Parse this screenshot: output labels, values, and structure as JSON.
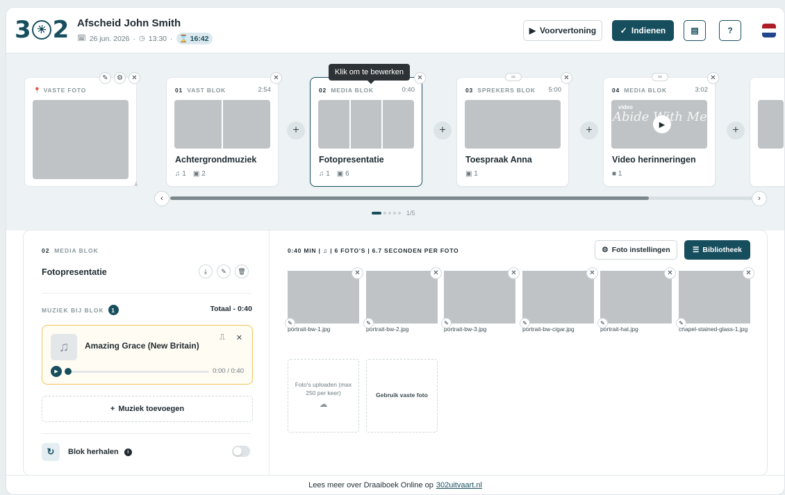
{
  "header": {
    "logo": "302",
    "title": "Afscheid John Smith",
    "date": "26 jun. 2026",
    "time": "13:30",
    "duration": "16:42",
    "preview_label": "Voorvertoning",
    "submit_label": "Indienen",
    "help_label": "?"
  },
  "timeline": {
    "tooltip": "Klik om te bewerken",
    "fixed_photo_label": "VASTE FOTO",
    "pagination": "1/5",
    "cards": [
      {
        "num": "01",
        "type": "VAST BLOK",
        "time": "2:54",
        "title": "Achtergrondmuziek",
        "music": "1",
        "photos": "2"
      },
      {
        "num": "02",
        "type": "MEDIA BLOK",
        "time": "0:40",
        "title": "Fotopresentatie",
        "music": "1",
        "photos": "6"
      },
      {
        "num": "03",
        "type": "SPREKERS BLOK",
        "time": "5:00",
        "title": "Toespraak Anna",
        "photos": "1"
      },
      {
        "num": "04",
        "type": "MEDIA BLOK",
        "time": "3:02",
        "title": "Video herinneringen",
        "videos": "1",
        "video_tag": "video",
        "video_overlay": "Abide With Me"
      }
    ]
  },
  "editor": {
    "num": "02",
    "type": "MEDIA BLOK",
    "title": "Fotopresentatie",
    "music_label": "MUZIEK BIJ BLOK",
    "music_count": "1",
    "music_total": "Totaal - 0:40",
    "track_name": "Amazing Grace (New Britain)",
    "track_time": "0:00 / 0:40",
    "add_music_label": "Muziek toevoegen",
    "repeat_label": "Blok herhalen",
    "summary": "0:40 MIN | ♫ | 6 FOTO'S | 6.7 SECONDEN PER FOTO",
    "photo_settings_label": "Foto instellingen",
    "library_label": "Bibliotheek",
    "photos": [
      "portrait-bw-1.jpg",
      "portrait-bw-2.jpg",
      "portrait-bw-3.jpg",
      "portrait-bw-cigar.jpg",
      "portrait-hat.jpg",
      "chapel-stained-glass-1.jpg"
    ],
    "upload_label": "Foto's uploaden (max 250 per keer)",
    "use_fixed_label": "Gebruik vaste foto"
  },
  "footer": {
    "text": "Lees meer over Draaiboek Online op",
    "link": "302uitvaart.nl"
  },
  "colors": {
    "primary": "#174e5e",
    "accent": "#f0c35a"
  }
}
